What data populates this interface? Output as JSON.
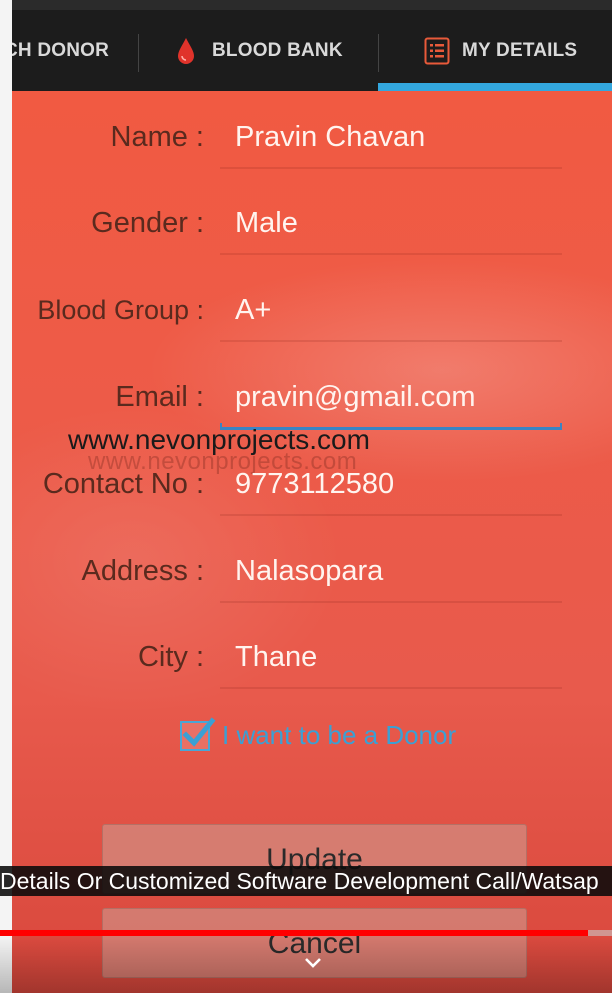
{
  "tabs": [
    {
      "label": "CH DONOR",
      "icon": "search-icon"
    },
    {
      "label": "BLOOD BANK",
      "icon": "blood-drop-icon"
    },
    {
      "label": "MY DETAILS",
      "icon": "list-icon",
      "selected": true
    }
  ],
  "form": {
    "name": {
      "label": "Name :",
      "value": "Pravin Chavan"
    },
    "gender": {
      "label": "Gender :",
      "value": "Male"
    },
    "blood_group": {
      "label": "Blood Group :",
      "value": "A+"
    },
    "email": {
      "label": "Email :",
      "value": "pravin@gmail.com"
    },
    "contact": {
      "label": "Contact No :",
      "value": "9773112580"
    },
    "address": {
      "label": "Address :",
      "value": "Nalasopara"
    },
    "city": {
      "label": "City :",
      "value": "Thane"
    }
  },
  "donor_checkbox": {
    "label": "I want to be a Donor",
    "checked": true
  },
  "buttons": {
    "update": "Update",
    "cancel": "Cancel"
  },
  "watermark": {
    "primary": "www.nevonprojects.com",
    "faded": "www.nevonprojects.com"
  },
  "video": {
    "caption": "Details Or Customized Software Development Call/Watsap",
    "progress_fraction": 0.96
  },
  "colors": {
    "accent": "#33a7de",
    "background": "#ee5b47",
    "tabbar": "#1c1c1c",
    "progress": "#ff0000"
  }
}
